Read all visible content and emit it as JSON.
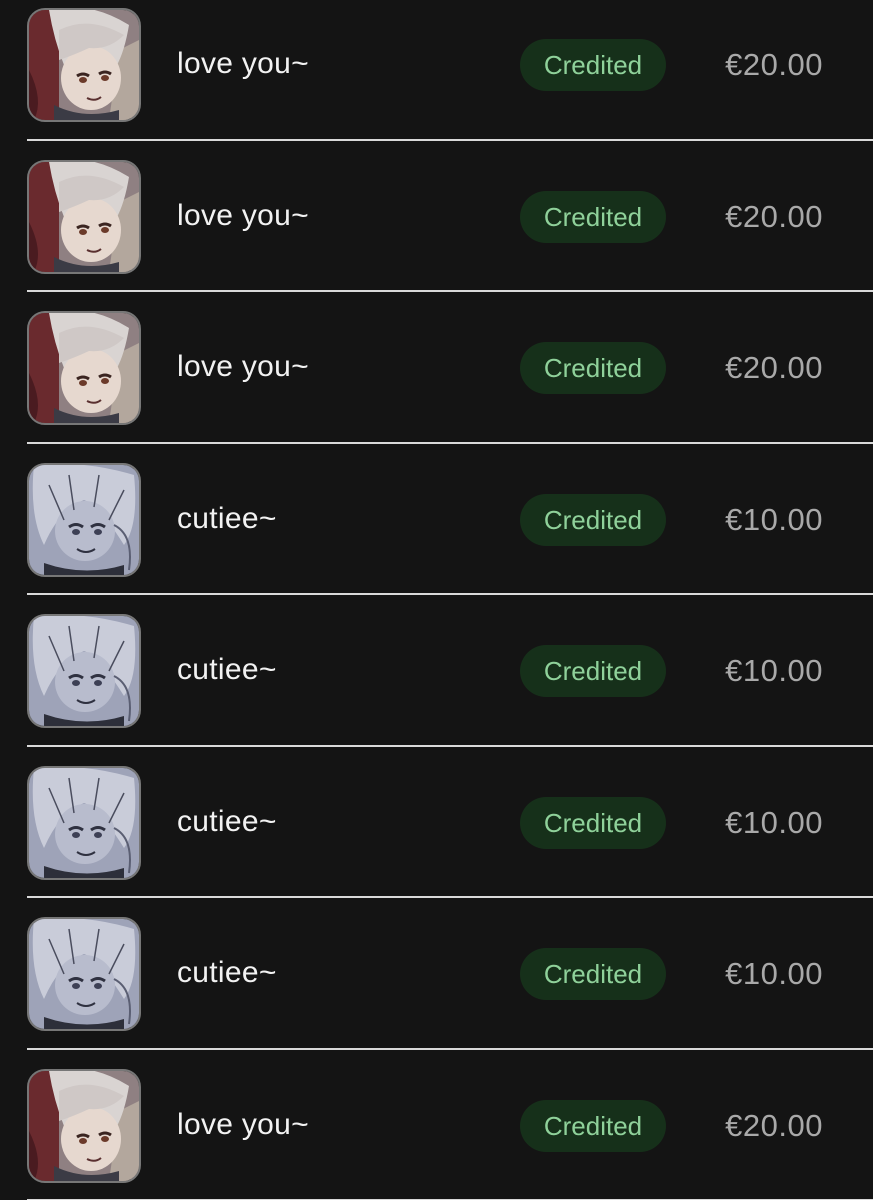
{
  "transactions": [
    {
      "title": "love you~",
      "status": "Credited",
      "amount": "€20.00",
      "avatar": "anime-girl-red-avatar"
    },
    {
      "title": "love you~",
      "status": "Credited",
      "amount": "€20.00",
      "avatar": "anime-girl-red-avatar"
    },
    {
      "title": "love you~",
      "status": "Credited",
      "amount": "€20.00",
      "avatar": "anime-girl-red-avatar"
    },
    {
      "title": "cutiee~",
      "status": "Credited",
      "amount": "€10.00",
      "avatar": "anime-girl-blue-avatar"
    },
    {
      "title": "cutiee~",
      "status": "Credited",
      "amount": "€10.00",
      "avatar": "anime-girl-blue-avatar"
    },
    {
      "title": "cutiee~",
      "status": "Credited",
      "amount": "€10.00",
      "avatar": "anime-girl-blue-avatar"
    },
    {
      "title": "cutiee~",
      "status": "Credited",
      "amount": "€10.00",
      "avatar": "anime-girl-blue-avatar"
    },
    {
      "title": "love you~",
      "status": "Credited",
      "amount": "€20.00",
      "avatar": "anime-girl-red-avatar"
    }
  ],
  "colors": {
    "background": "#141414",
    "badge_bg": "#16301a",
    "badge_text": "#8fd19a",
    "amount_text": "#a9a9a9",
    "title_text": "#f2f2f2"
  }
}
